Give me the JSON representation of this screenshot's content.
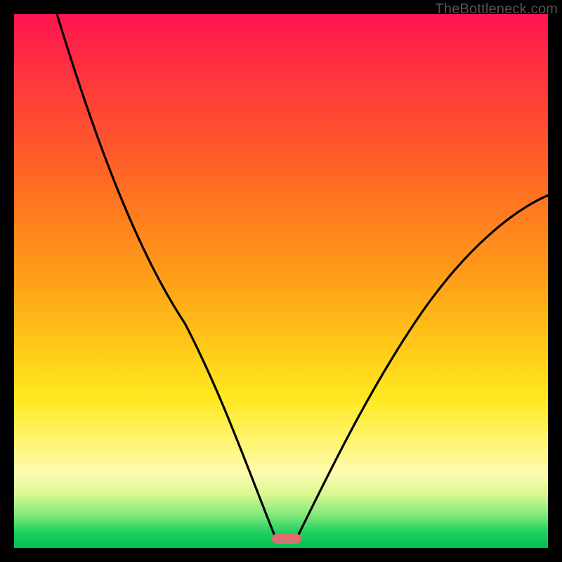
{
  "watermark": "TheBottleneck.com",
  "colors": {
    "frame_bg": "#000000",
    "watermark": "#555555",
    "curve_stroke": "#000000",
    "marker_fill": "#d87070",
    "gradient": [
      "#ff1450",
      "#ff3040",
      "#ff5030",
      "#ff7520",
      "#ffa018",
      "#ffc818",
      "#ffe820",
      "#fff570",
      "#fffbb0",
      "#d8f890",
      "#7de87a",
      "#20d060",
      "#00c050"
    ]
  },
  "chart_data": {
    "type": "line",
    "title": "",
    "xlabel": "",
    "ylabel": "",
    "xlim": [
      0,
      100
    ],
    "ylim": [
      0,
      100
    ],
    "grid": false,
    "legend": false,
    "annotations": [
      {
        "kind": "marker",
        "shape": "rounded-rect",
        "x": 50,
        "y": 2,
        "color": "#d87070"
      }
    ],
    "series": [
      {
        "name": "left-curve",
        "x": [
          8,
          12,
          16,
          20,
          24,
          28,
          32,
          36,
          40,
          44,
          47,
          49
        ],
        "y": [
          100,
          90,
          80,
          70,
          61,
          52,
          42,
          32,
          22,
          12,
          5,
          2
        ]
      },
      {
        "name": "right-curve",
        "x": [
          53,
          56,
          60,
          65,
          70,
          76,
          82,
          90,
          100
        ],
        "y": [
          2,
          6,
          12,
          20,
          28,
          37,
          46,
          56,
          66
        ]
      }
    ],
    "note": "Values are read off the image in percentage coordinates (0–100 on each axis); the plot has no numeric tick labels, so values are gridline estimates."
  }
}
